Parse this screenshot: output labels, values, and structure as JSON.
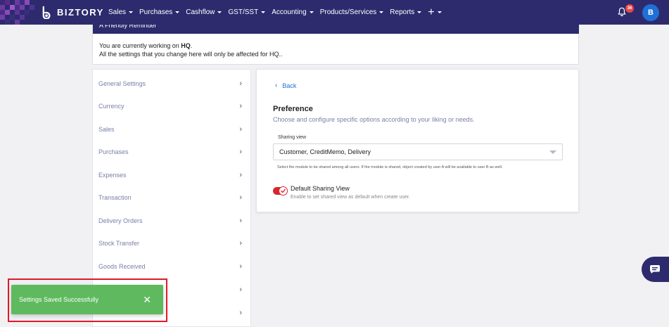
{
  "brand": {
    "name": "BIZTORY"
  },
  "nav": {
    "items": [
      {
        "label": "Sales"
      },
      {
        "label": "Purchases"
      },
      {
        "label": "Cashflow"
      },
      {
        "label": "GST/SST"
      },
      {
        "label": "Accounting"
      },
      {
        "label": "Products/Services"
      },
      {
        "label": "Reports"
      }
    ],
    "plus_label": "+"
  },
  "header": {
    "notification_count": "36",
    "avatar_initial": "B"
  },
  "reminder": {
    "title": "A Friendly Reminder",
    "line1_prefix": "You are currently working on ",
    "line1_branch": "HQ",
    "line1_suffix": ".",
    "line2": "All the settings that you change here will only be affected for HQ.."
  },
  "menu": {
    "items": [
      {
        "label": "General Settings"
      },
      {
        "label": "Currency"
      },
      {
        "label": "Sales"
      },
      {
        "label": "Purchases"
      },
      {
        "label": "Expenses"
      },
      {
        "label": "Transaction"
      },
      {
        "label": "Delivery Orders"
      },
      {
        "label": "Stock Transfer"
      },
      {
        "label": "Goods Received"
      },
      {
        "label": ""
      },
      {
        "label": ""
      }
    ]
  },
  "preference": {
    "back_label": "Back",
    "title": "Preference",
    "description": "Choose and configure specific options according to your liking or needs.",
    "sharing_view_label": "Sharing view",
    "sharing_view_value": "Customer, CreditMemo, Delivery",
    "sharing_view_help": "Select the module to be shared among all users. If the module is shared, object created by user A will be available to user B as well.",
    "default_toggle_label": "Default Sharing View",
    "default_toggle_help": "Enable to set shared view as default when create user.",
    "default_toggle_on": true
  },
  "toast": {
    "message": "Settings Saved Successfully",
    "close_symbol": "✕"
  },
  "colors": {
    "nav_bg": "#2d2b6e",
    "accent_blue": "#1e6fd9",
    "toggle_red": "#d8262e",
    "toast_green": "#5fb95f",
    "highlight_red": "#e0192a",
    "menu_text": "#7a7fa8"
  }
}
